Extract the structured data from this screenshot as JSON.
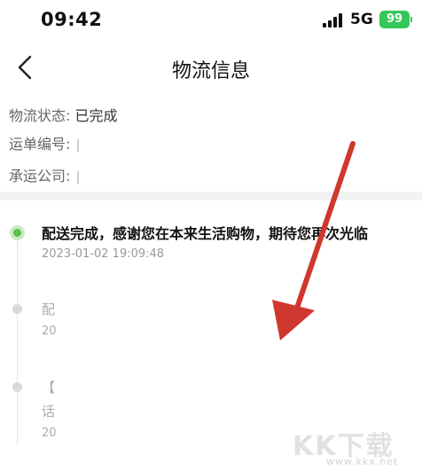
{
  "status_bar": {
    "time": "09:42",
    "network": "5G",
    "battery": "99"
  },
  "nav": {
    "title": "物流信息"
  },
  "info": {
    "status_label": "物流状态:",
    "status_value": "已完成",
    "waybill_label": "运单编号:",
    "carrier_label": "承运公司:"
  },
  "timeline": [
    {
      "title": "配送完成，感谢您在本来生活购物，期待您再次光临",
      "time": "2023-01-02 19:09:48"
    },
    {
      "title": "配",
      "time": "20"
    },
    {
      "title_line1": "【",
      "title_line2": "话",
      "time": "20"
    }
  ],
  "watermark": {
    "logo": "KK下载",
    "url": "www.kkx.net"
  },
  "colors": {
    "accent": "#5cbf4a",
    "arrow": "#d0372e",
    "battery": "#34c759"
  }
}
